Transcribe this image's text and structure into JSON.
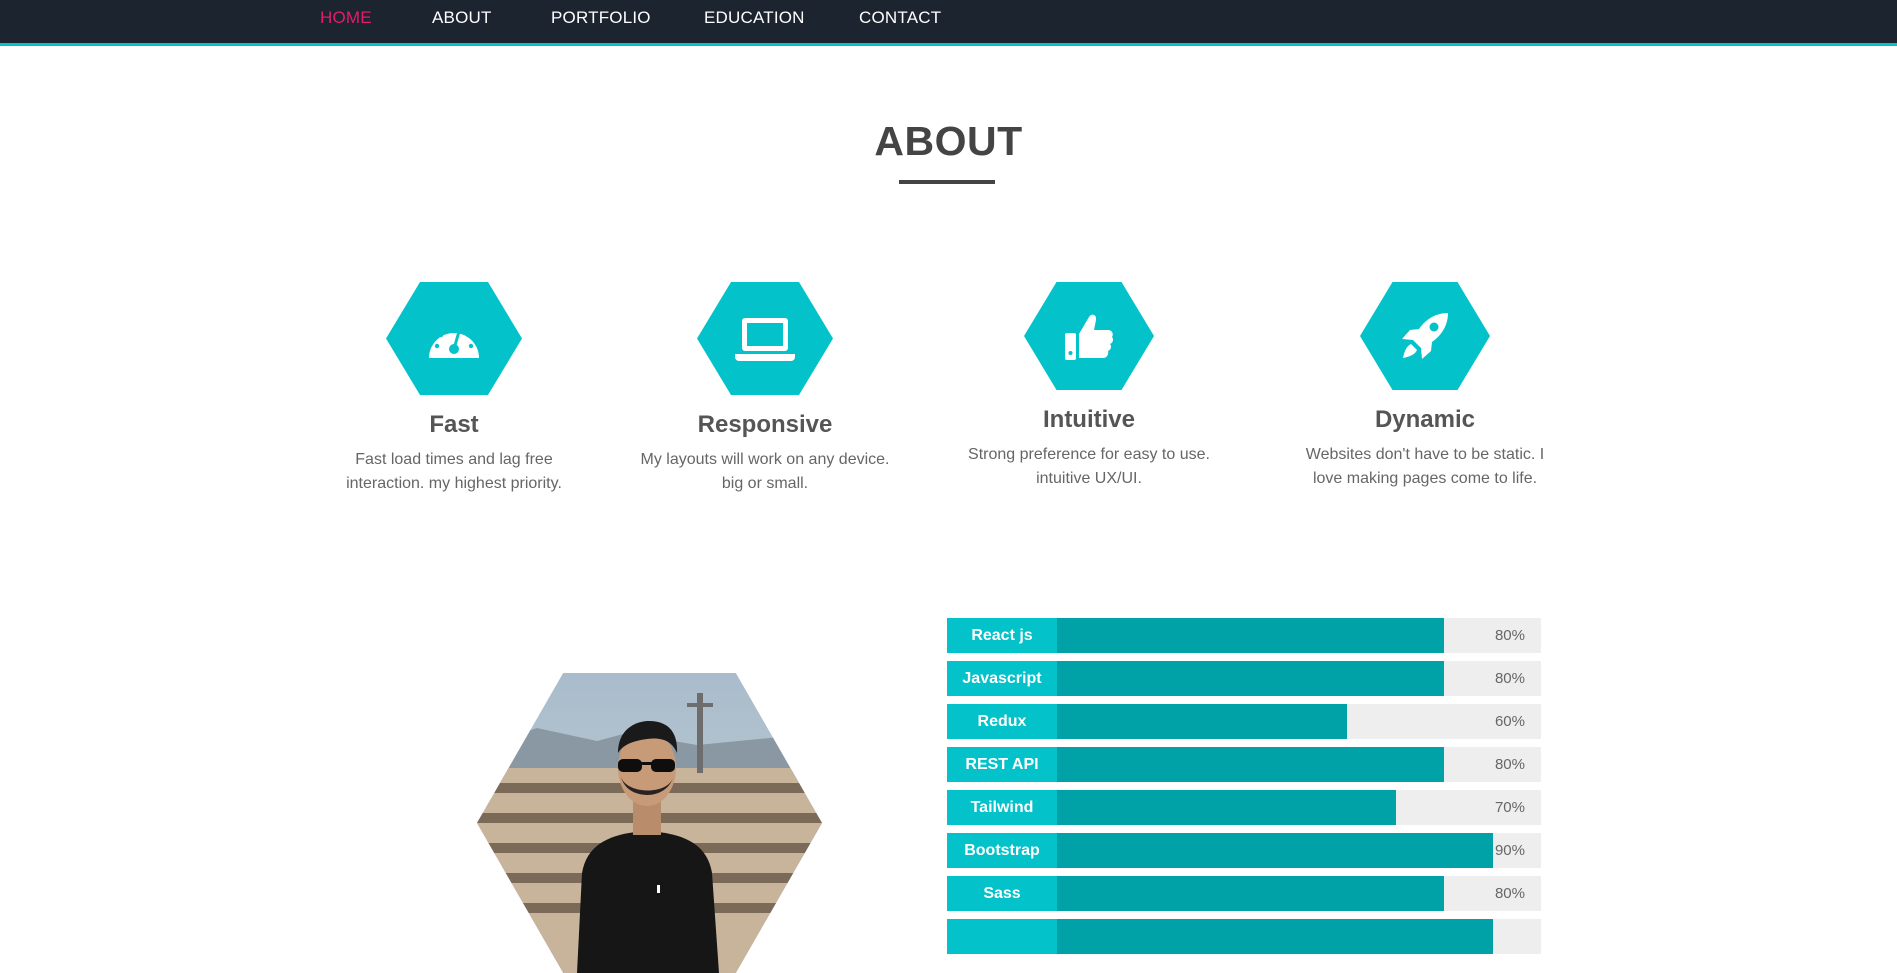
{
  "nav": {
    "items": [
      {
        "label": "HOME",
        "active": true
      },
      {
        "label": "ABOUT",
        "active": false
      },
      {
        "label": "PORTFOLIO",
        "active": false
      },
      {
        "label": "EDUCATION",
        "active": false
      },
      {
        "label": "CONTACT",
        "active": false
      }
    ]
  },
  "about": {
    "title": "ABOUT"
  },
  "features": [
    {
      "icon": "speedometer-icon",
      "title": "Fast",
      "line1": "Fast load times and lag free",
      "line2": "interaction. my highest priority."
    },
    {
      "icon": "laptop-icon",
      "title": "Responsive",
      "line1": "My layouts will work on any device.",
      "line2": "big or small."
    },
    {
      "icon": "thumbs-up-icon",
      "title": "Intuitive",
      "line1": "Strong preference for easy to use.",
      "line2": "intuitive UX/UI."
    },
    {
      "icon": "rocket-icon",
      "title": "Dynamic",
      "line1": "Websites don't have to be static. I",
      "line2": "love making pages come to life."
    }
  ],
  "skills": [
    {
      "name": "React js",
      "percent": 80,
      "label": "80%"
    },
    {
      "name": "Javascript",
      "percent": 80,
      "label": "80%"
    },
    {
      "name": "Redux",
      "percent": 60,
      "label": "60%"
    },
    {
      "name": "REST API",
      "percent": 80,
      "label": "80%"
    },
    {
      "name": "Tailwind",
      "percent": 70,
      "label": "70%"
    },
    {
      "name": "Bootstrap",
      "percent": 90,
      "label": "90%"
    },
    {
      "name": "Sass",
      "percent": 80,
      "label": "80%"
    },
    {
      "name": "",
      "percent": 90,
      "label": ""
    }
  ],
  "colors": {
    "nav_bg": "#1b242f",
    "accent": "#04c2c9",
    "accent_dark": "#00a1a7",
    "active_nav": "#e31b6d"
  }
}
